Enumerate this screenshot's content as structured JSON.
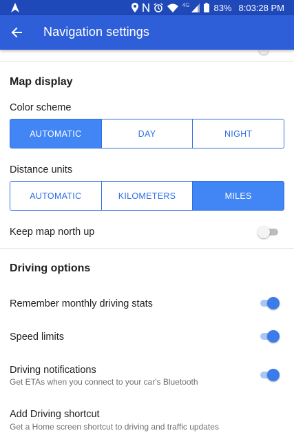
{
  "status_bar": {
    "network_type": "4G",
    "battery": "83%",
    "time": "8:03:28 PM",
    "icons": [
      "navigation-arrow-icon",
      "location-icon",
      "nfc-icon",
      "alarm-icon",
      "wifi-icon",
      "signal-icon",
      "battery-icon"
    ]
  },
  "app_bar": {
    "back_icon": "arrow-left-icon",
    "title": "Navigation settings"
  },
  "colors": {
    "status_bar": "#1f48b8",
    "app_bar": "#2e5fd9",
    "accent": "#4285f4"
  },
  "map_display": {
    "title": "Map display",
    "color_scheme": {
      "label": "Color scheme",
      "options": [
        "AUTOMATIC",
        "DAY",
        "NIGHT"
      ],
      "selected": "AUTOMATIC"
    },
    "distance_units": {
      "label": "Distance units",
      "options": [
        "AUTOMATIC",
        "KILOMETERS",
        "MILES"
      ],
      "selected": "MILES"
    },
    "keep_north_up": {
      "label": "Keep map north up",
      "enabled": false
    }
  },
  "driving_options": {
    "title": "Driving options",
    "items": [
      {
        "label": "Remember monthly driving stats",
        "enabled": true
      },
      {
        "label": "Speed limits",
        "enabled": true
      },
      {
        "label": "Driving notifications",
        "sublabel": "Get ETAs when you connect to your car's Bluetooth",
        "enabled": true
      }
    ],
    "shortcut": {
      "label": "Add Driving shortcut",
      "sublabel": "Get a Home screen shortcut to driving and traffic updates"
    }
  }
}
